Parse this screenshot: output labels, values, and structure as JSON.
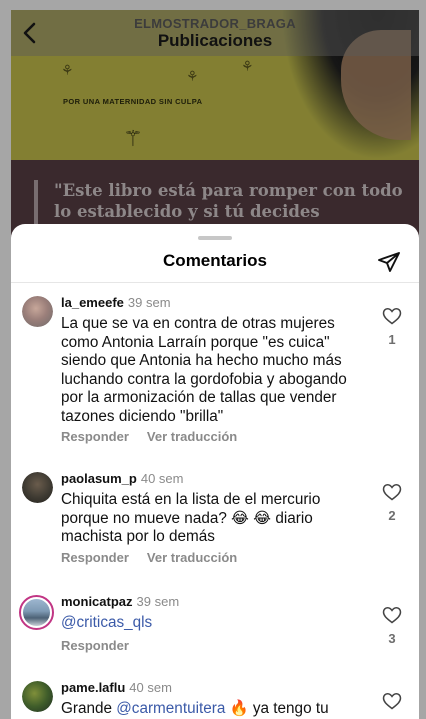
{
  "header": {
    "username": "ELMOSTRADOR_BRAGA",
    "title": "Publicaciones"
  },
  "post": {
    "tagline": "POR UNA MATERNIDAD SIN CULPA",
    "quote": "\"Este libro está para romper con todo lo establecido y si tú decides"
  },
  "sheet": {
    "title": "Comentarios"
  },
  "comments": [
    {
      "username": "la_emeefe",
      "time": "39 sem",
      "text": "La que se va en contra de otras mujeres como Antonia Larraín porque \"es cuica\" siendo que Antonia ha hecho mucho más luchando contra la gordofobia y abogando por la armonización de tallas que vender tazones diciendo \"brilla\"",
      "reply": "Responder",
      "translate": "Ver traducción",
      "likes": "1"
    },
    {
      "username": "paolasum_p",
      "time": "40 sem",
      "text": "Chiquita está en la lista de el mercurio porque no mueve nada? 😂 😂 diario machista por lo demás",
      "reply": "Responder",
      "translate": "Ver traducción",
      "likes": "2"
    },
    {
      "username": "monicatpaz",
      "time": "39 sem",
      "text": "@criticas_qls",
      "reply": "Responder",
      "likes": "3"
    },
    {
      "username": "pame.laflu",
      "time": "40 sem",
      "text_prefix": "Grande ",
      "mention": "@carmentuitera",
      "text_suffix": " 🔥 ya tengo tu"
    }
  ],
  "colors": {
    "mention": "#3b5aa8",
    "secondary_text": "#8a8a8a",
    "story_ring": "#c13584"
  },
  "icons": [
    "back-chevron-icon",
    "send-icon",
    "heart-outline-icon"
  ]
}
